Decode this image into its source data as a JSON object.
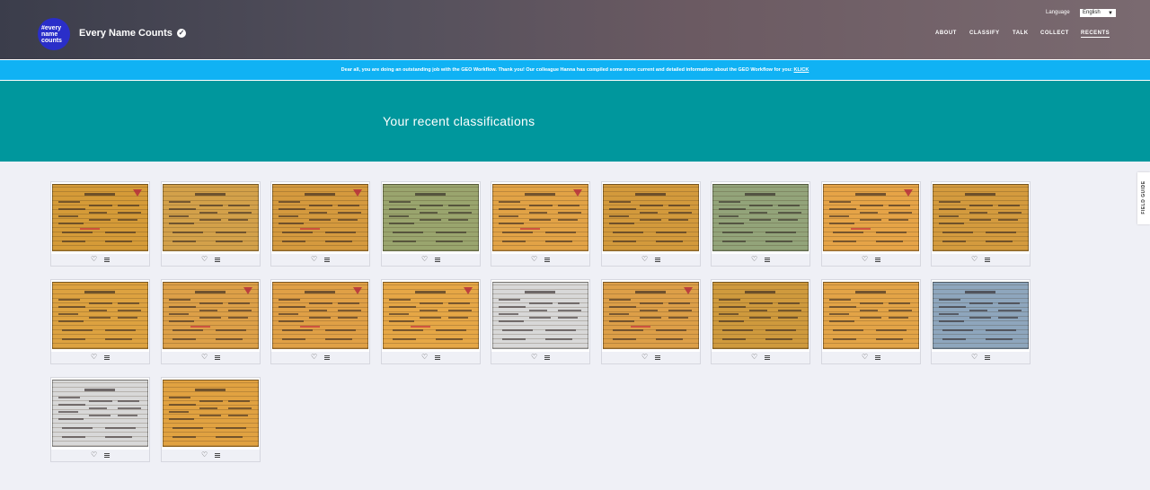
{
  "header": {
    "logo_text": "#every name counts",
    "project_title": "Every Name Counts",
    "language_label": "Language",
    "language_value": "English",
    "nav": [
      {
        "label": "ABOUT",
        "active": false
      },
      {
        "label": "CLASSIFY",
        "active": false
      },
      {
        "label": "TALK",
        "active": false
      },
      {
        "label": "COLLECT",
        "active": false
      },
      {
        "label": "RECENTS",
        "active": true
      }
    ]
  },
  "banner": {
    "text": "Dear all, you are doing an outstanding job with the GEO Workflow. Thank you! Our colleague Hanna has compiled some more current and detailed information about the GEO Workflow for you:",
    "link_text": "KLICK"
  },
  "hero": {
    "title": "Your recent classifications"
  },
  "field_guide_label": "FIELD GUIDE",
  "icons": {
    "favorite": "heart-icon",
    "collect": "collect-icon",
    "verified": "check-badge-icon"
  },
  "colors": {
    "banner": "#10b2f4",
    "hero": "#00979d",
    "logo": "#2a2ec9"
  },
  "classifications": [
    {
      "tint": "#d59b38",
      "mark": true
    },
    {
      "tint": "#d3a14a",
      "mark": false
    },
    {
      "tint": "#d59a3e",
      "mark": true
    },
    {
      "tint": "#9aa56e",
      "mark": false
    },
    {
      "tint": "#e2a346",
      "mark": true
    },
    {
      "tint": "#d39a3c",
      "mark": false
    },
    {
      "tint": "#93a47a",
      "mark": false
    },
    {
      "tint": "#e6a447",
      "mark": true
    },
    {
      "tint": "#d49b3e",
      "mark": false
    },
    {
      "tint": "#dda240",
      "mark": false
    },
    {
      "tint": "#dda048",
      "mark": true
    },
    {
      "tint": "#e0a046",
      "mark": true
    },
    {
      "tint": "#e6a746",
      "mark": true
    },
    {
      "tint": "#d8d8d8",
      "mark": false
    },
    {
      "tint": "#dd9f48",
      "mark": true
    },
    {
      "tint": "#cf9a3d",
      "mark": false
    },
    {
      "tint": "#e3a447",
      "mark": false
    },
    {
      "tint": "#8ea6bd",
      "mark": false
    },
    {
      "tint": "#d8d8d8",
      "mark": false
    },
    {
      "tint": "#e1a241",
      "mark": false
    }
  ]
}
